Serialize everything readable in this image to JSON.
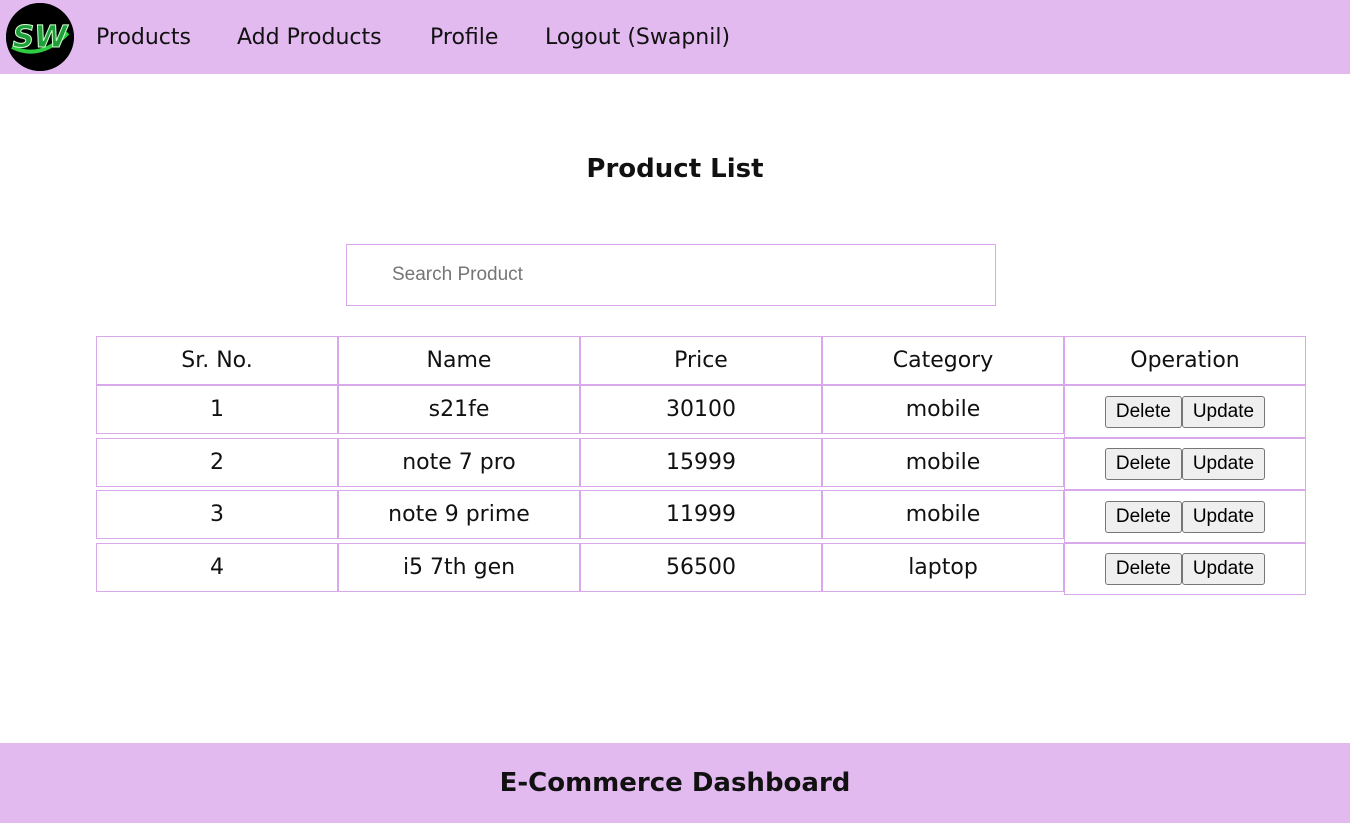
{
  "nav": {
    "logo_text": "SW",
    "links": [
      "Products",
      "Add Products",
      "Profile",
      "Logout (Swapnil)"
    ]
  },
  "page": {
    "title": "Product List",
    "search_placeholder": "Search Product"
  },
  "table": {
    "headers": [
      "Sr. No.",
      "Name",
      "Price",
      "Category",
      "Operation"
    ],
    "rows": [
      [
        "1",
        "s21fe",
        "30100",
        "mobile"
      ],
      [
        "2",
        "note 7 pro",
        "15999",
        "mobile"
      ],
      [
        "3",
        "note 9 prime",
        "11999",
        "mobile"
      ],
      [
        "4",
        "i5 7th gen",
        "56500",
        "laptop"
      ]
    ],
    "delete_label": "Delete",
    "update_label": "Update"
  },
  "footer": {
    "title": "E-Commerce Dashboard"
  },
  "colors": {
    "bar": "#e3baf0",
    "border": "#d9a8ea",
    "logo_green": "#1f9e3a"
  }
}
